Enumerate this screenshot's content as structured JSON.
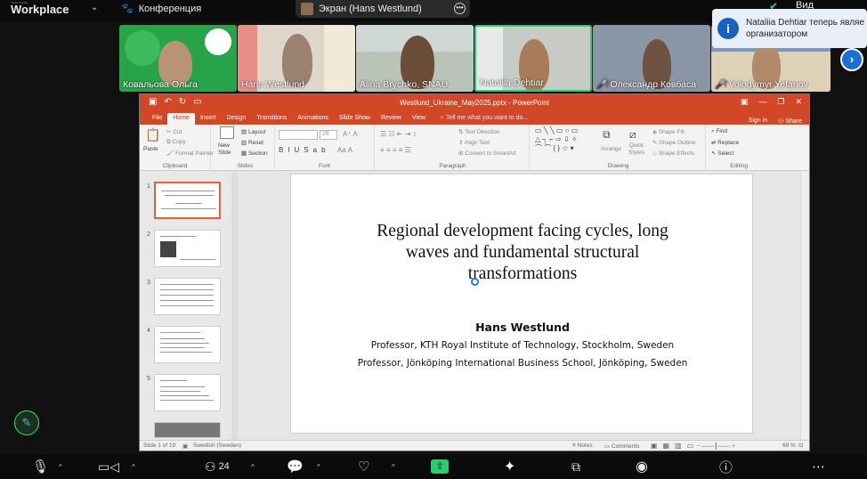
{
  "app": {
    "brand_small": "zoom",
    "brand": "Workplace",
    "conference_label": "Конференция"
  },
  "screen_share": {
    "label": "Экран (Hans Westlund)"
  },
  "top_right": {
    "view_label": "Вид"
  },
  "toast": {
    "text_line1": "Nataliia Dehtiar теперь являе",
    "text_line2": "организатором",
    "icon": "info-icon"
  },
  "gallery": {
    "participants": [
      {
        "name": "Ковальова Ольга",
        "muted": false
      },
      {
        "name": "Hans Westlund",
        "muted": false
      },
      {
        "name": "Alina Brychko, SNAU",
        "muted": false
      },
      {
        "name": "Nataliia Dehtiar",
        "muted": false,
        "active": true
      },
      {
        "name": "Олександр Ковбаса",
        "muted": true
      },
      {
        "name": "Volodymyr Yefanov",
        "muted": true
      }
    ]
  },
  "ppt": {
    "window_title": "Westlund_Ukraine_May2025.pptx - PowerPoint",
    "tabs": [
      "File",
      "Home",
      "Insert",
      "Design",
      "Transitions",
      "Animations",
      "Slide Show",
      "Review",
      "View"
    ],
    "tell_me": "Tell me what you want to do...",
    "sign_in": "Sign in",
    "share": "Share",
    "ribbon": {
      "clipboard": {
        "paste": "Paste",
        "cut": "Cut",
        "copy": "Copy",
        "format_painter": "Format Painter",
        "caption": "Clipboard"
      },
      "slides": {
        "new_slide": "New Slide",
        "layout": "Layout",
        "reset": "Reset",
        "section": "Section",
        "caption": "Slides"
      },
      "font": {
        "size": "28",
        "caption": "Font"
      },
      "paragraph": {
        "text_direction": "Text Direction",
        "align_text": "Align Text",
        "convert": "Convert to SmartArt",
        "caption": "Paragraph"
      },
      "drawing": {
        "arrange": "Arrange",
        "quick_styles": "Quick Styles",
        "shape_fill": "Shape Fill",
        "shape_outline": "Shape Outline",
        "shape_effects": "Shape Effects",
        "caption": "Drawing"
      },
      "editing": {
        "find": "Find",
        "replace": "Replace",
        "select": "Select",
        "caption": "Editing"
      }
    },
    "thumbnails": [
      "1",
      "2",
      "3",
      "4",
      "5"
    ],
    "slide": {
      "title_line1": "Regional development facing cycles, long",
      "title_line2": "waves and fundamental structural",
      "title_line3": "transformations",
      "author": "Hans Westlund",
      "affiliation1": "Professor, KTH Royal Institute of Technology, Stockholm, Sweden",
      "affiliation2": "Professor, Jönköping International Business School, Jönköping, Sweden"
    },
    "status": {
      "slide_of": "Slide 1 of 19",
      "language": "Swedish (Sweden)",
      "notes": "Notes",
      "comments": "Comments",
      "zoom": "69 %"
    }
  },
  "toolbar": {
    "participants_count": "24"
  },
  "colors": {
    "ppt_accent": "#d24726",
    "zoom_blue": "#1a6fd6",
    "share_green": "#2ecc71"
  }
}
